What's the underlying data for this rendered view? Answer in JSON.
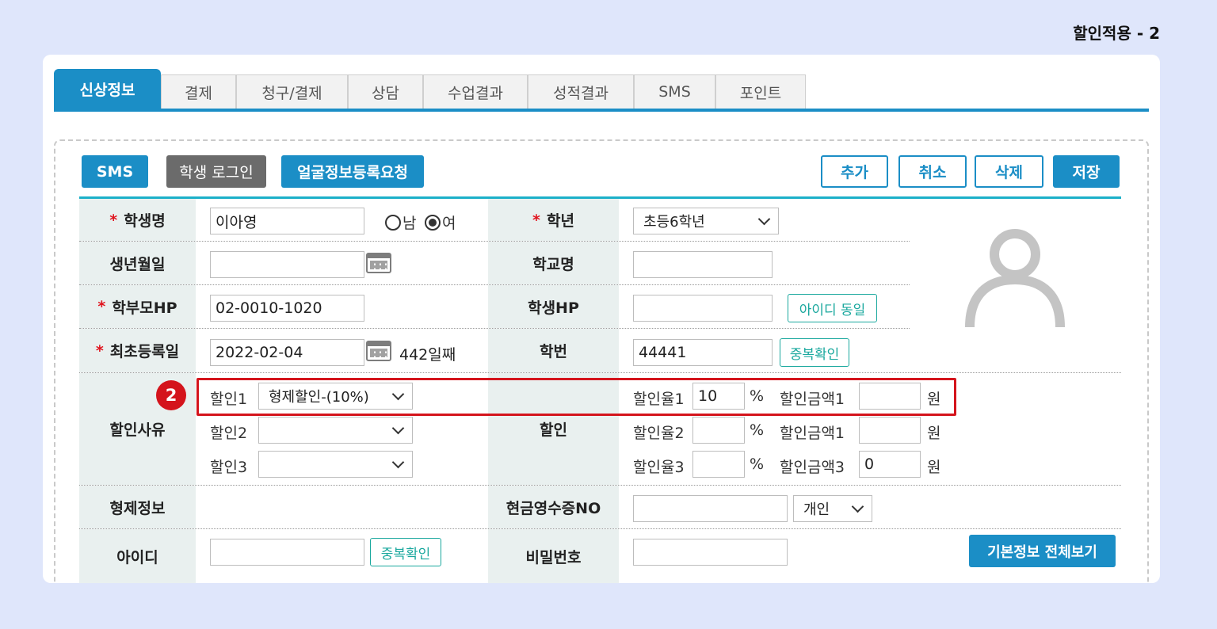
{
  "page_label": "할인적용 - 2",
  "tabs": [
    "신상정보",
    "결제",
    "청구/결제",
    "상담",
    "수업결과",
    "성적결과",
    "SMS",
    "포인트"
  ],
  "toolbar": {
    "sms": "SMS",
    "student_login": "학생 로그인",
    "face_request": "얼굴정보등록요청",
    "add": "추가",
    "cancel": "취소",
    "delete": "삭제",
    "save": "저장"
  },
  "form": {
    "req_mark": "*",
    "student_name_label": "학생명",
    "student_name": "이아영",
    "gender_male": "남",
    "gender_female": "여",
    "grade_label": "학년",
    "grade": "초등6학년",
    "birth_label": "생년월일",
    "birth": "",
    "school_label": "학교명",
    "school": "",
    "parent_hp_label": "학부모HP",
    "parent_hp": "02-0010-1020",
    "student_hp_label": "학생HP",
    "student_hp": "",
    "same_as_id": "아이디 동일",
    "first_reg_label": "최초등록일",
    "first_reg": "2022-02-04",
    "days": "442일째",
    "student_no_label": "학번",
    "student_no": "44441",
    "dup_check": "중복확인",
    "discount_reason_label": "할인사유",
    "discount_label": "할인",
    "discounts": [
      {
        "label": "할인1",
        "select": "형제할인-(10%)",
        "rate_label": "할인율1",
        "rate": "10",
        "amount_label": "할인금액1",
        "amount": ""
      },
      {
        "label": "할인2",
        "select": "",
        "rate_label": "할인율2",
        "rate": "",
        "amount_label": "할인금액1",
        "amount": ""
      },
      {
        "label": "할인3",
        "select": "",
        "rate_label": "할인율3",
        "rate": "",
        "amount_label": "할인금액3",
        "amount": "0"
      }
    ],
    "percent": "%",
    "won": "원",
    "sibling_label": "형제정보",
    "cash_receipt_label": "현금영수증NO",
    "cash_receipt": "",
    "cash_receipt_type": "개인",
    "id_label": "아이디",
    "id": "",
    "password_label": "비밀번호",
    "password": "",
    "view_all": "기본정보 전체보기"
  },
  "step_badge": "2"
}
